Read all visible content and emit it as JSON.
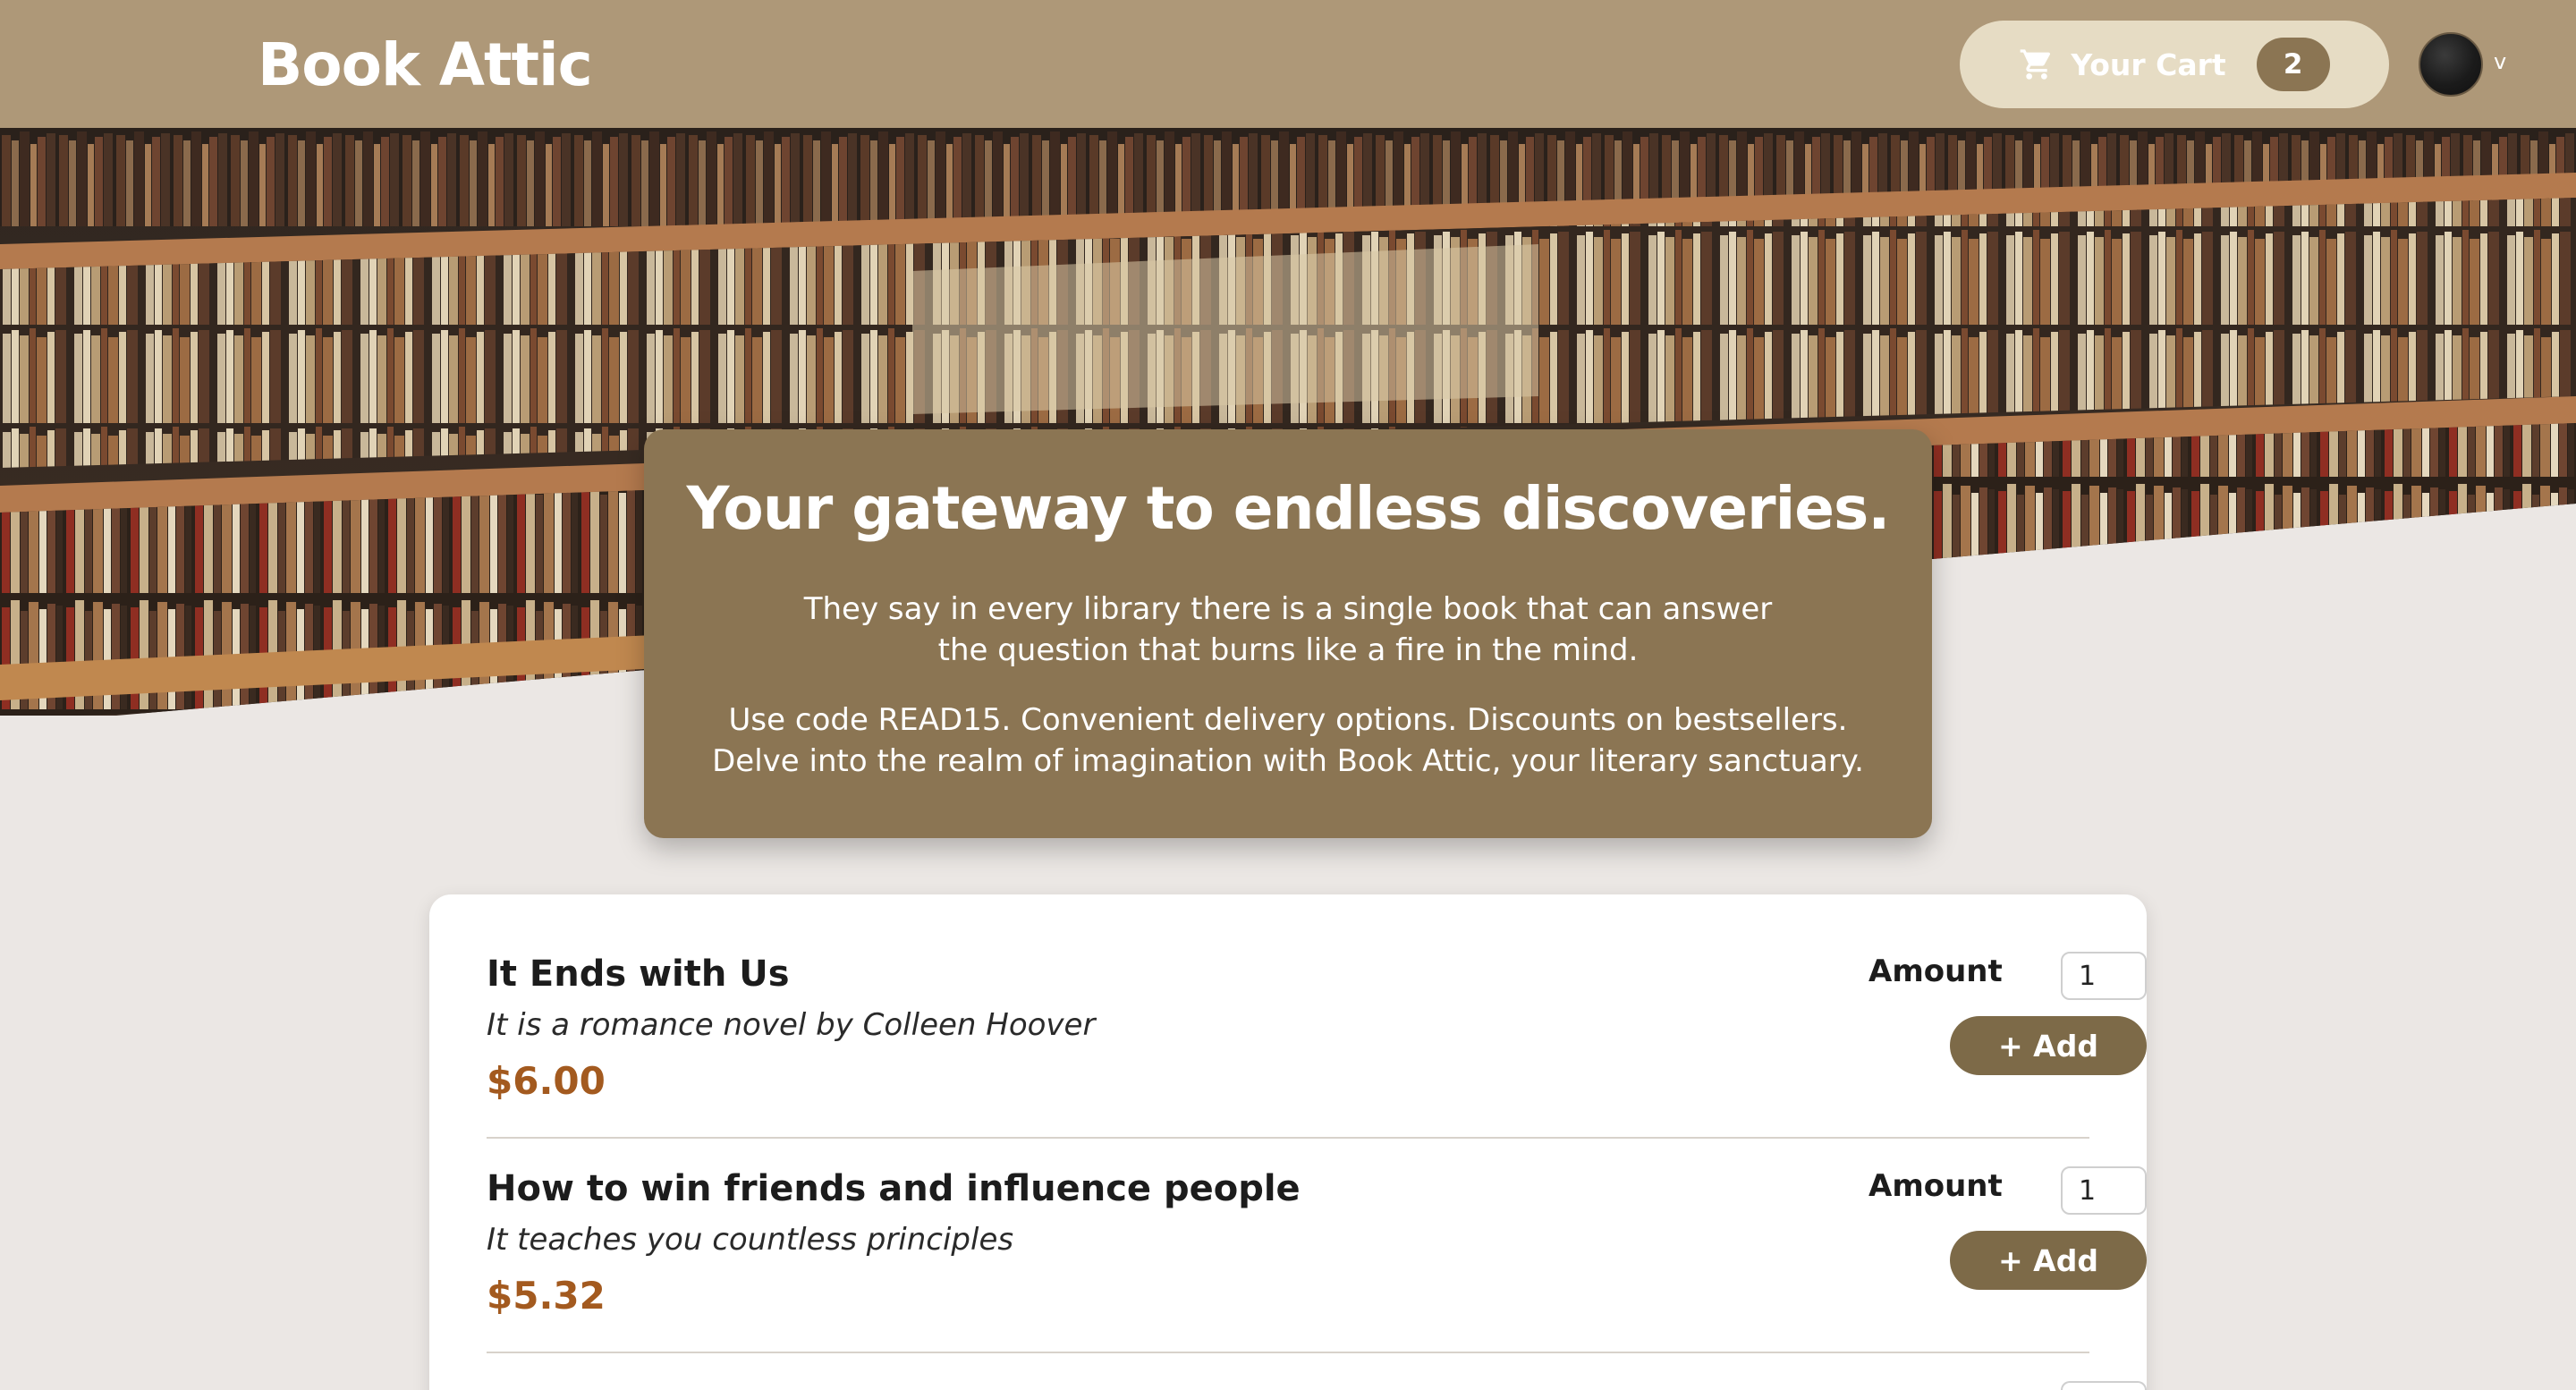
{
  "header": {
    "brand": "Book Attic",
    "cart_label": "Your Cart",
    "cart_count": "2",
    "avatar_caret": "v"
  },
  "hero": {
    "title": "Your gateway to endless discoveries.",
    "paragraph1": "They say in every library there is a single book that can answer the question that burns like a fire in the mind.",
    "paragraph2": "Use code READ15. Convenient delivery options. Discounts on bestsellers. Delve into the realm of imagination with Book Attic, your literary sanctuary."
  },
  "products": [
    {
      "name": "It Ends with Us",
      "description": "It is a romance novel by Colleen Hoover",
      "price": "$6.00",
      "amount_label": "Amount",
      "amount_value": "1",
      "add_label": "+ Add"
    },
    {
      "name": "How to win friends and influence people",
      "description": "It teaches you countless principles",
      "price": "$5.32",
      "amount_label": "Amount",
      "amount_value": "1",
      "add_label": "+ Add"
    }
  ],
  "colors": {
    "header_bg": "#ae9878",
    "cart_bg": "#e6dcc4",
    "hero_card_bg": "#8b7553",
    "add_button_bg": "#7d6a48",
    "price": "#a35a1f",
    "page_bg": "#ebe7e4"
  },
  "icons": {
    "cart": "shopping-cart-icon",
    "avatar": "user-avatar"
  }
}
